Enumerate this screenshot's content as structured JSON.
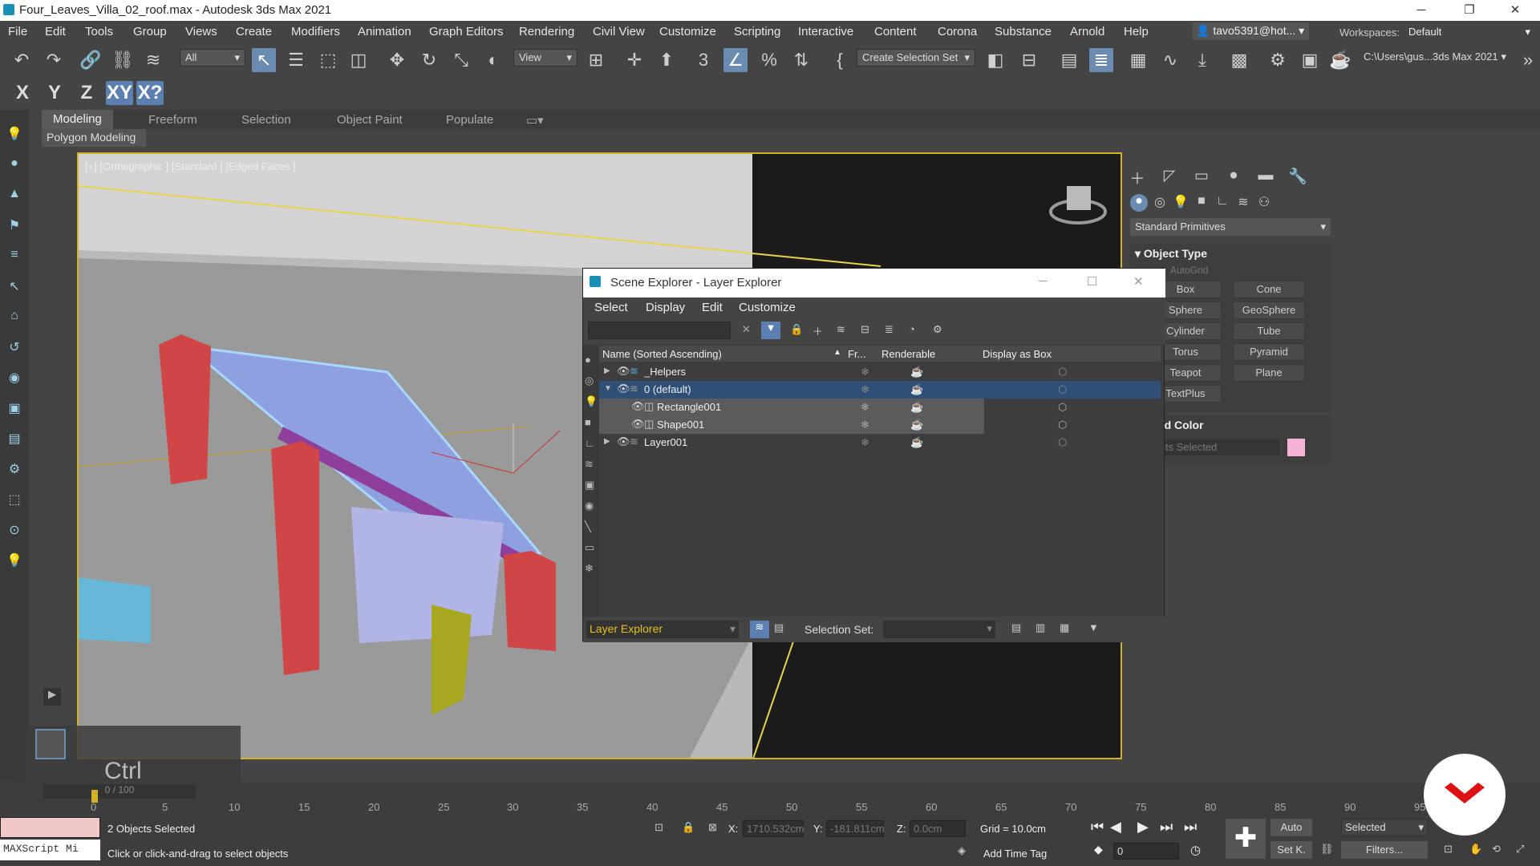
{
  "window": {
    "title": "Four_Leaves_Villa_02_roof.max - Autodesk 3ds Max 2021",
    "minimize": "─",
    "maximize": "❐",
    "close": "✕"
  },
  "menu": [
    "File",
    "Edit",
    "Tools",
    "Group",
    "Views",
    "Create",
    "Modifiers",
    "Animation",
    "Graph Editors",
    "Rendering",
    "Civil View",
    "Customize",
    "Scripting",
    "Interactive",
    "Content",
    "Corona",
    "Substance",
    "Arnold",
    "Help"
  ],
  "user": {
    "label": "tavo5391@hot...",
    "caret": "▾"
  },
  "workspaces": {
    "label": "Workspaces:",
    "value": "Default"
  },
  "toolbar": {
    "filter": "All",
    "refcoord": "View",
    "selset": "Create Selection Set",
    "project_path": "C:\\Users\\gus...3ds Max 2021"
  },
  "axis": [
    "X",
    "Y",
    "Z",
    "XY",
    "X?"
  ],
  "ribbon": {
    "tabs": [
      "Modeling",
      "Freeform",
      "Selection",
      "Object Paint",
      "Populate"
    ],
    "sub": "Polygon Modeling"
  },
  "viewport": {
    "label": "[+] [Orthographic ] [Standard ] [Edged Faces ]"
  },
  "command_panel": {
    "dropdown": "Standard Primitives",
    "object_type_title": "Object Type",
    "autogrid": "AutoGrid",
    "primitives": [
      [
        "Box",
        "Cone"
      ],
      [
        "Sphere",
        "GeoSphere"
      ],
      [
        "Cylinder",
        "Tube"
      ],
      [
        "Torus",
        "Pyramid"
      ],
      [
        "Teapot",
        "Plane"
      ],
      [
        "TextPlus",
        ""
      ]
    ],
    "name_color_title": "ne and Color",
    "objects_selected": "Objects Selected",
    "swatch_color": "#f5b3d6"
  },
  "explorer": {
    "title": "Scene Explorer - Layer Explorer",
    "menu": [
      "Select",
      "Display",
      "Edit",
      "Customize"
    ],
    "cols": {
      "name": "Name (Sorted Ascending)",
      "sort": "▲",
      "fr": "Fr...",
      "renderable": "Renderable",
      "display_box": "Display as Box"
    },
    "rows": [
      {
        "name": "_Helpers",
        "expander": "▶",
        "indent": 0
      },
      {
        "name": "0 (default)",
        "expander": "▼",
        "indent": 0
      },
      {
        "name": "Rectangle001",
        "expander": "",
        "indent": 1
      },
      {
        "name": "Shape001",
        "expander": "",
        "indent": 1
      },
      {
        "name": "Layer001",
        "expander": "▶",
        "indent": 0
      }
    ],
    "footer": {
      "explorer_name": "Layer Explorer",
      "selection_set_label": "Selection Set:"
    }
  },
  "timeline": {
    "frame": "0 / 100",
    "ticks": [
      "0",
      "5",
      "10",
      "15",
      "20",
      "25",
      "30",
      "35",
      "40",
      "45",
      "50",
      "55",
      "60",
      "65",
      "70",
      "75",
      "80",
      "85",
      "90",
      "95"
    ]
  },
  "status": {
    "selected": "2 Objects Selected",
    "prompt": "Click or click-and-drag to select objects",
    "maxscript": "MAXScript Mi",
    "x_label": "X:",
    "x": "1710.532cm",
    "y_label": "Y:",
    "y": "-181.811cm",
    "z_label": "Z:",
    "z": "0.0cm",
    "grid": "Grid = 10.0cm",
    "add_time_tag": "Add Time Tag",
    "auto": "Auto",
    "setk": "Set K.",
    "selected_dd": "Selected",
    "filters": "Filters...",
    "frame_value": "0"
  },
  "overlay": {
    "key_hint": "Ctrl"
  }
}
